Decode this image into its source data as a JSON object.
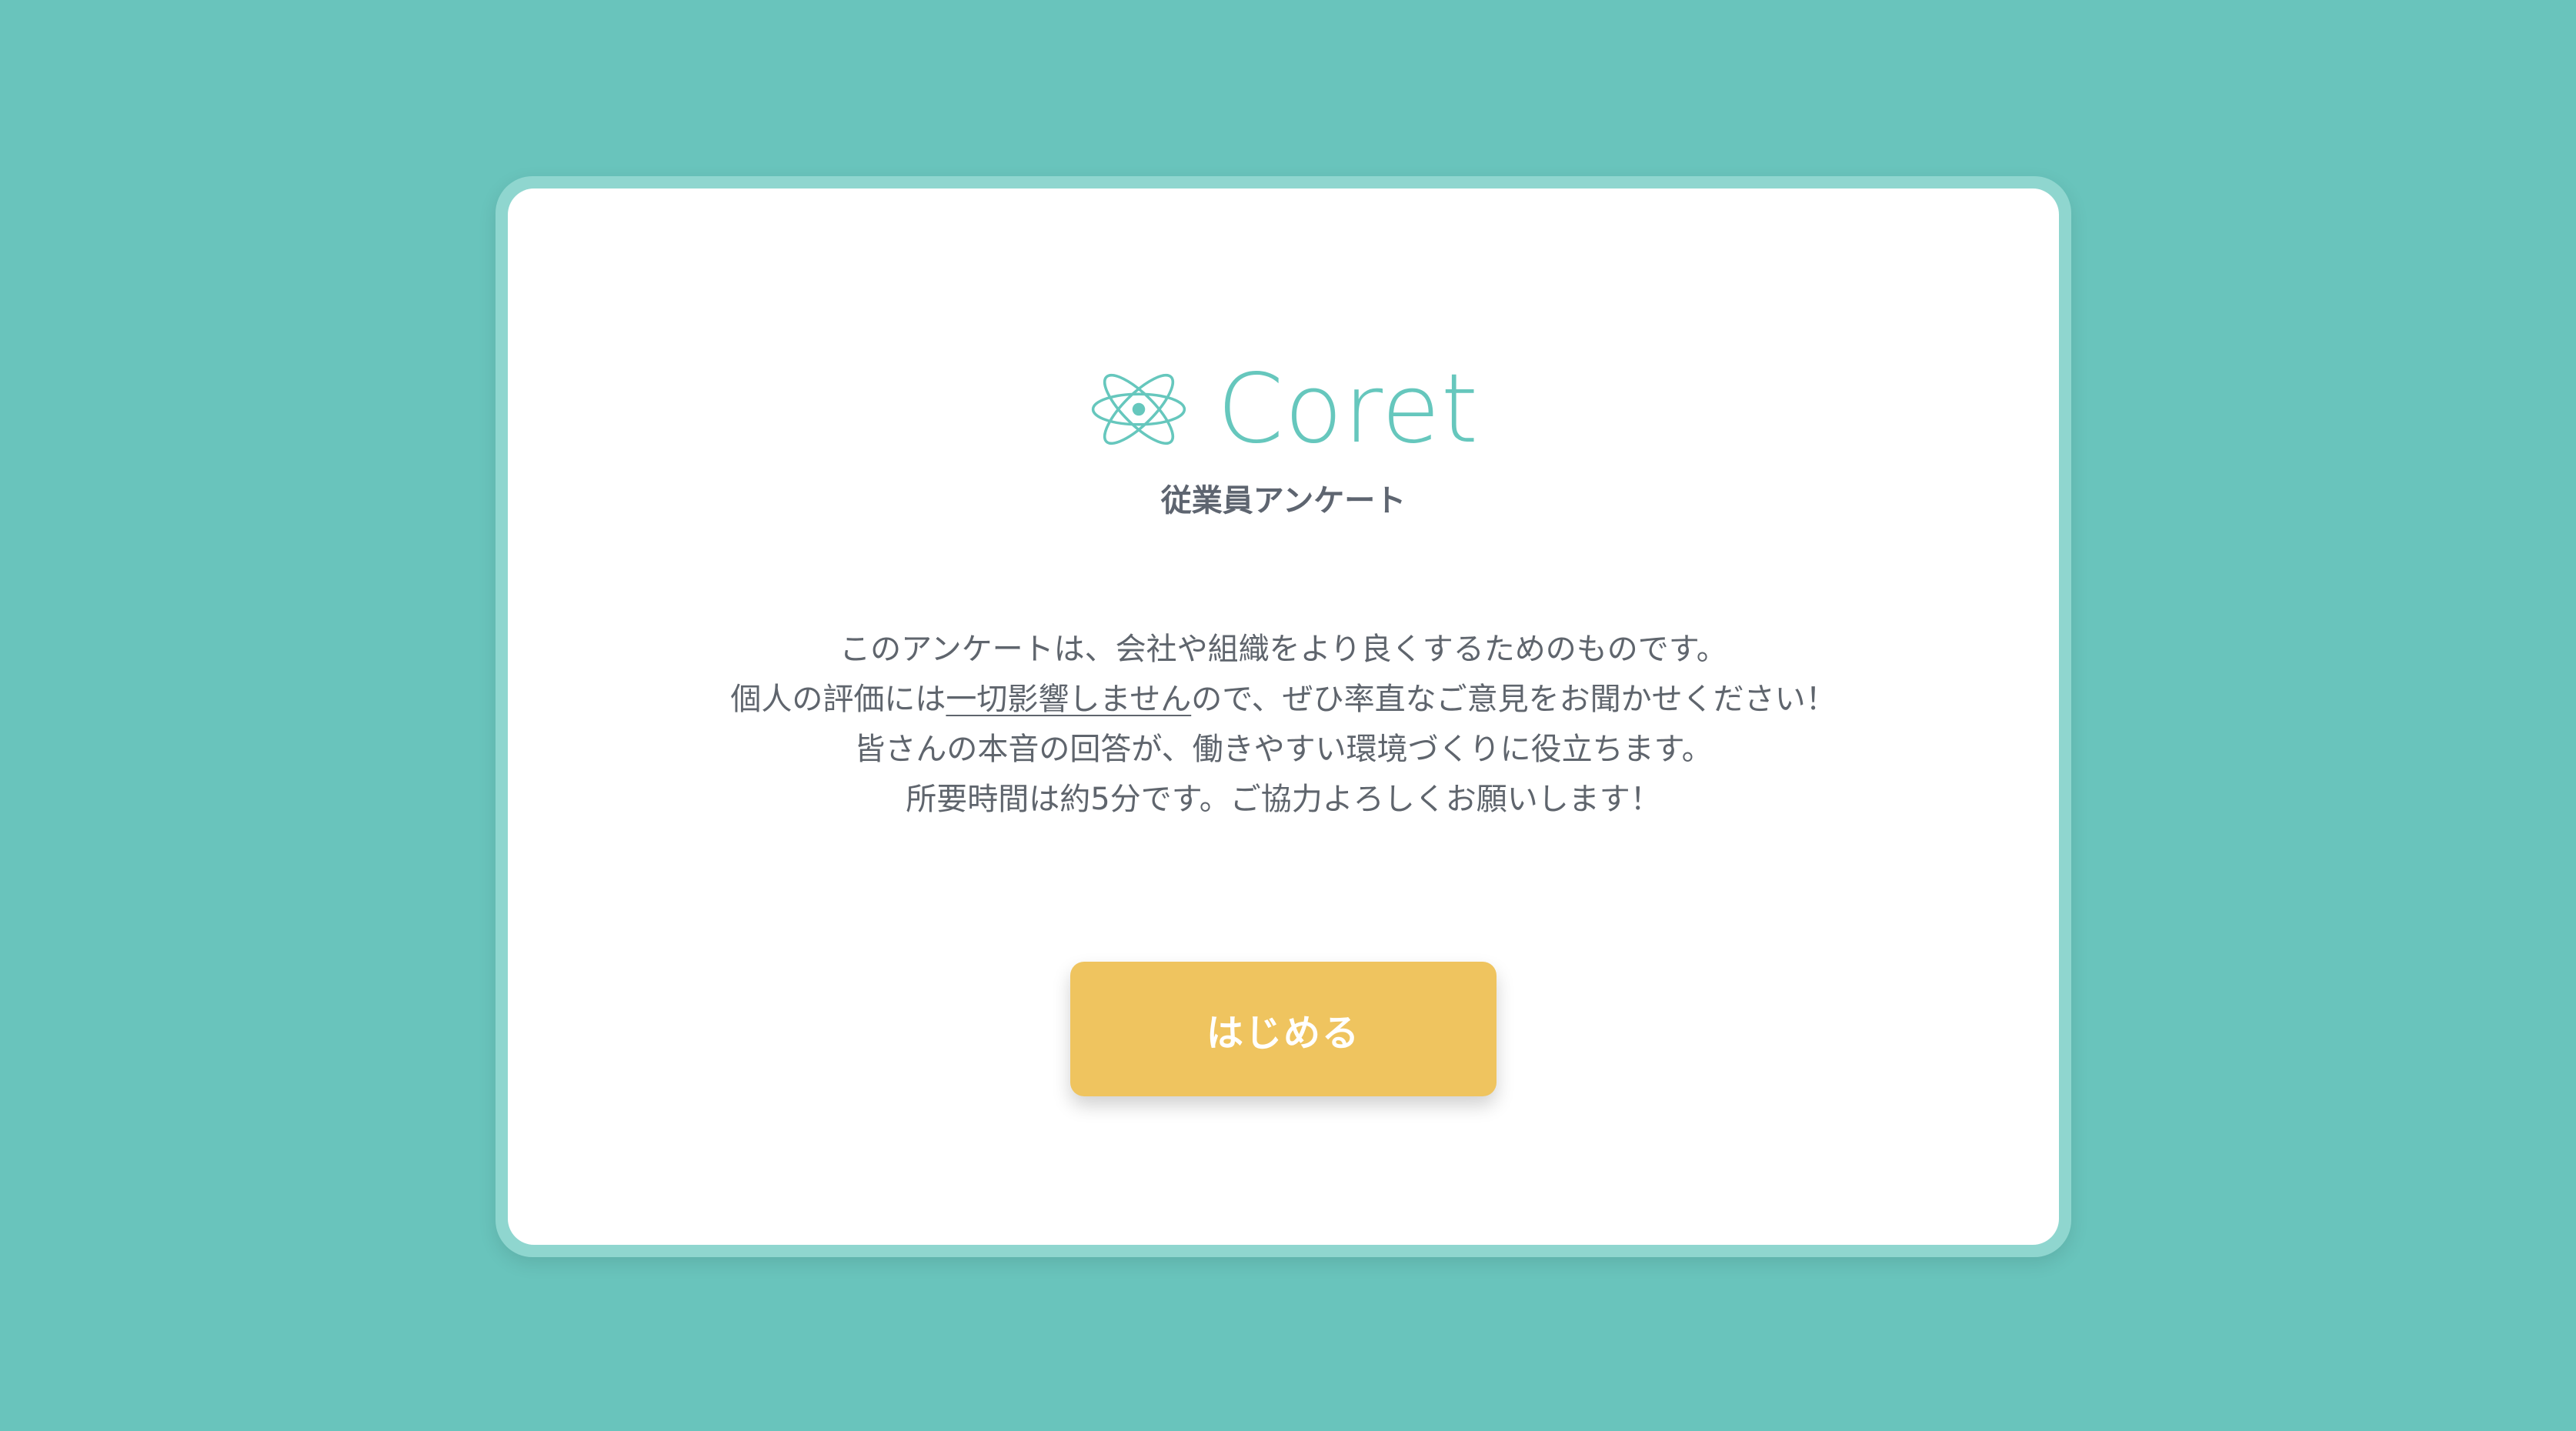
{
  "brand": {
    "icon": "atom-icon",
    "name": "Coret",
    "accent_color": "#66c7bd"
  },
  "page": {
    "subtitle": "従業員アンケート"
  },
  "description": {
    "line1": "このアンケートは、会社や組織をより良くするためのものです。",
    "line2_before": "個人の評価には",
    "line2_emphasis": "一切影響しません",
    "line2_after": "ので、ぜひ率直なご意見をお聞かせください！",
    "line3": "皆さんの本音の回答が、働きやすい環境づくりに役立ちます。",
    "line4": "所要時間は約5分です。ご協力よろしくお願いします！"
  },
  "actions": {
    "start_label": "はじめる",
    "button_color": "#efc45f"
  },
  "theme": {
    "background": "#69c4bc",
    "card_border": "#8fd6cf",
    "card_background": "#ffffff"
  }
}
